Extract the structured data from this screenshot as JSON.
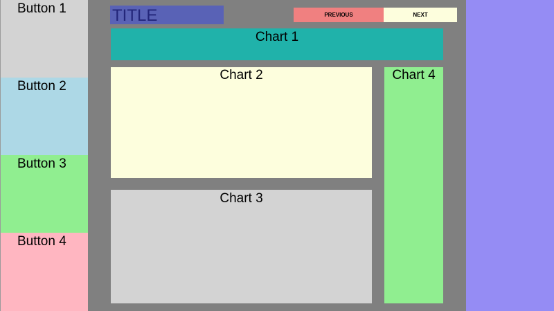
{
  "sidebar": {
    "buttons": [
      {
        "label": "Button 1",
        "color": "#d3d3d3"
      },
      {
        "label": "Button 2",
        "color": "#add8e6"
      },
      {
        "label": "Button 3",
        "color": "#90ee90"
      },
      {
        "label": "Button 4",
        "color": "#ffb6c1"
      }
    ]
  },
  "header": {
    "title": "TITLE",
    "title_bg_color": "#5962b6",
    "previous_label": "PREVIOUS",
    "next_label": "NEXT"
  },
  "charts": [
    {
      "label": "Chart 1",
      "color": "#20b2aa"
    },
    {
      "label": "Chart 2",
      "color": "#fdfedd"
    },
    {
      "label": "Chart 3",
      "color": "#d3d3d3"
    },
    {
      "label": "Chart 4",
      "color": "#90ee90"
    }
  ],
  "colors": {
    "main_bg": "#808080",
    "right_panel": "#958cf4",
    "previous_button": "#f08080",
    "next_button": "#fdfedd"
  }
}
